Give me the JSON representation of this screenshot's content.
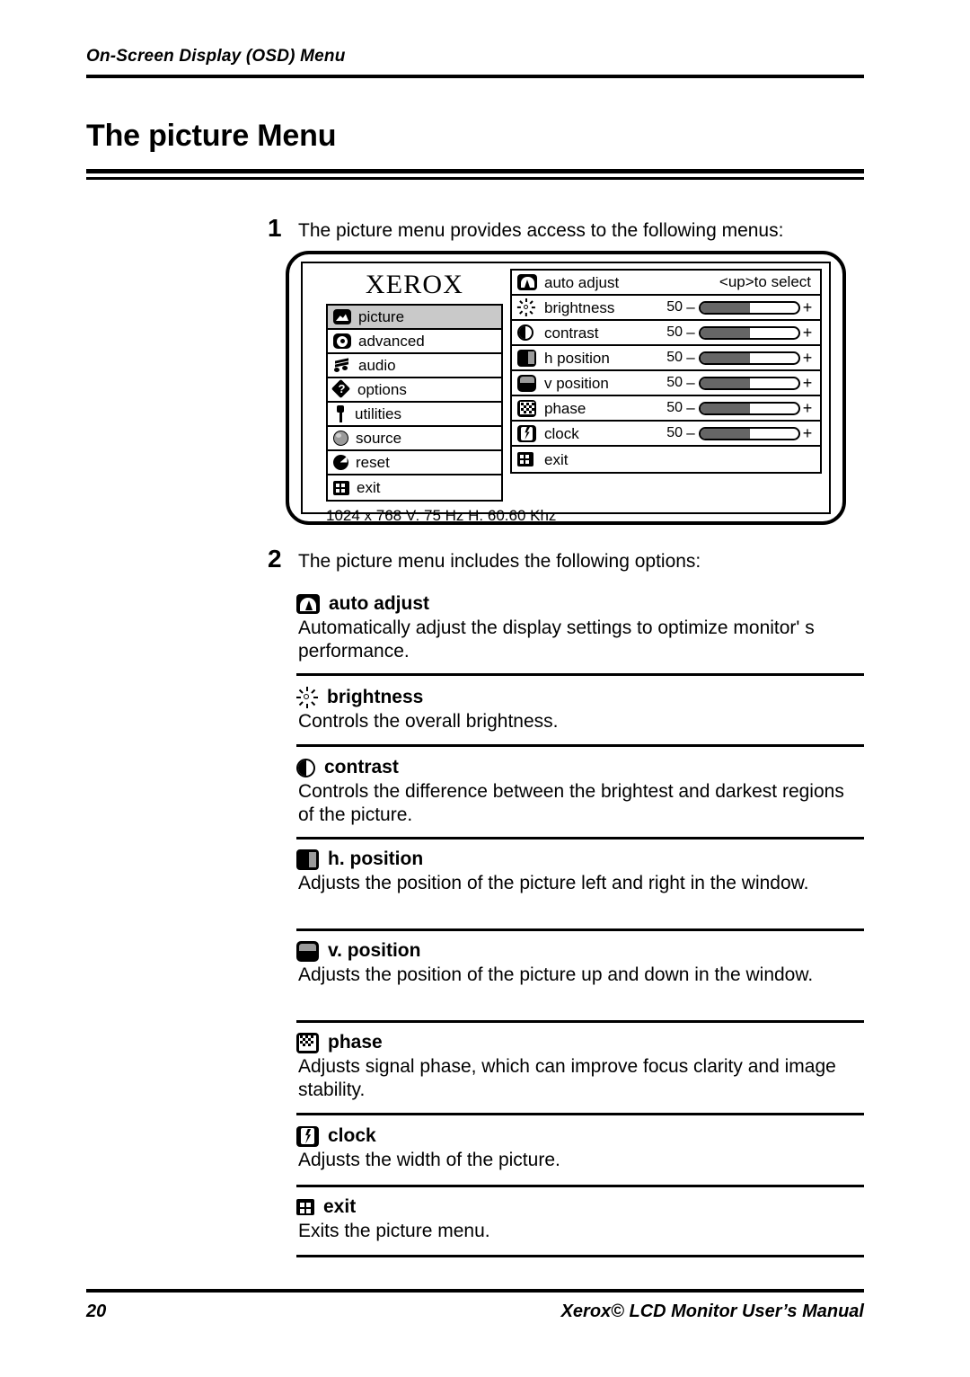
{
  "header": {
    "running_title": "On-Screen Display (OSD) Menu"
  },
  "chapter": {
    "title": "The picture Menu"
  },
  "steps": [
    {
      "number": "1",
      "text": "The picture menu provides access to the following menus:"
    },
    {
      "number": "2",
      "text": "The picture menu includes the following options:"
    }
  ],
  "osd": {
    "brand": "XEROX",
    "status_line": "1024 x 768 V: 75 Hz  H: 60.60 Khz",
    "select_hint": "<up>to select",
    "menu_items": [
      {
        "icon": "picture-icon",
        "label": "picture",
        "selected": true
      },
      {
        "icon": "advanced-icon",
        "label": "advanced",
        "selected": false
      },
      {
        "icon": "audio-icon",
        "label": "audio",
        "selected": false
      },
      {
        "icon": "options-icon",
        "label": "options",
        "selected": false
      },
      {
        "icon": "utilities-icon",
        "label": "utilities",
        "selected": false
      },
      {
        "icon": "source-icon",
        "label": "source",
        "selected": false
      },
      {
        "icon": "reset-icon",
        "label": "reset",
        "selected": false
      },
      {
        "icon": "exit-icon",
        "label": "exit",
        "selected": false
      }
    ],
    "option_rows": [
      {
        "icon": "auto-adjust-icon",
        "label": "auto adjust",
        "type": "hint",
        "hint": "<up>to select"
      },
      {
        "icon": "brightness-icon",
        "label": "brightness",
        "type": "slider",
        "value": "50",
        "fill_pct": 50,
        "minus": "–",
        "plus": "+"
      },
      {
        "icon": "contrast-icon",
        "label": "contrast",
        "type": "slider",
        "value": "50",
        "fill_pct": 50,
        "minus": "–",
        "plus": "+"
      },
      {
        "icon": "h-position-icon",
        "label": "h position",
        "type": "slider",
        "value": "50",
        "fill_pct": 50,
        "minus": "–",
        "plus": "+"
      },
      {
        "icon": "v-position-icon",
        "label": "v position",
        "type": "slider",
        "value": "50",
        "fill_pct": 50,
        "minus": "–",
        "plus": "+"
      },
      {
        "icon": "phase-icon",
        "label": "phase",
        "type": "slider",
        "value": "50",
        "fill_pct": 50,
        "minus": "–",
        "plus": "+"
      },
      {
        "icon": "clock-icon",
        "label": "clock",
        "type": "slider",
        "value": "50",
        "fill_pct": 50,
        "minus": "–",
        "plus": "+"
      },
      {
        "icon": "exit-icon",
        "label": "exit",
        "type": "plain"
      }
    ]
  },
  "options": [
    {
      "icon": "auto-adjust-icon",
      "title": "auto adjust",
      "description": "Automatically adjust the display settings to optimize monitor' s performance."
    },
    {
      "icon": "brightness-icon",
      "title": "brightness",
      "description": "Controls the overall brightness."
    },
    {
      "icon": "contrast-icon",
      "title": "contrast",
      "description": "Controls the difference between the brightest and darkest regions of the picture."
    },
    {
      "icon": "h-position-icon",
      "title": "h. position",
      "description": "Adjusts  the position of the picture left and right in the window."
    },
    {
      "icon": "v-position-icon",
      "title": "v. position",
      "description": "Adjusts the position of the picture up and down in the window."
    },
    {
      "icon": "phase-icon",
      "title": "phase",
      "description": "Adjusts signal phase, which can improve focus clarity and image stability."
    },
    {
      "icon": "clock-icon",
      "title": "clock",
      "description": "Adjusts the width of the picture."
    },
    {
      "icon": "exit-icon",
      "title": "exit",
      "description": "Exits the picture menu."
    }
  ],
  "footer": {
    "page_number": "20",
    "manual_title": "Xerox© LCD Monitor User’s Manual"
  }
}
